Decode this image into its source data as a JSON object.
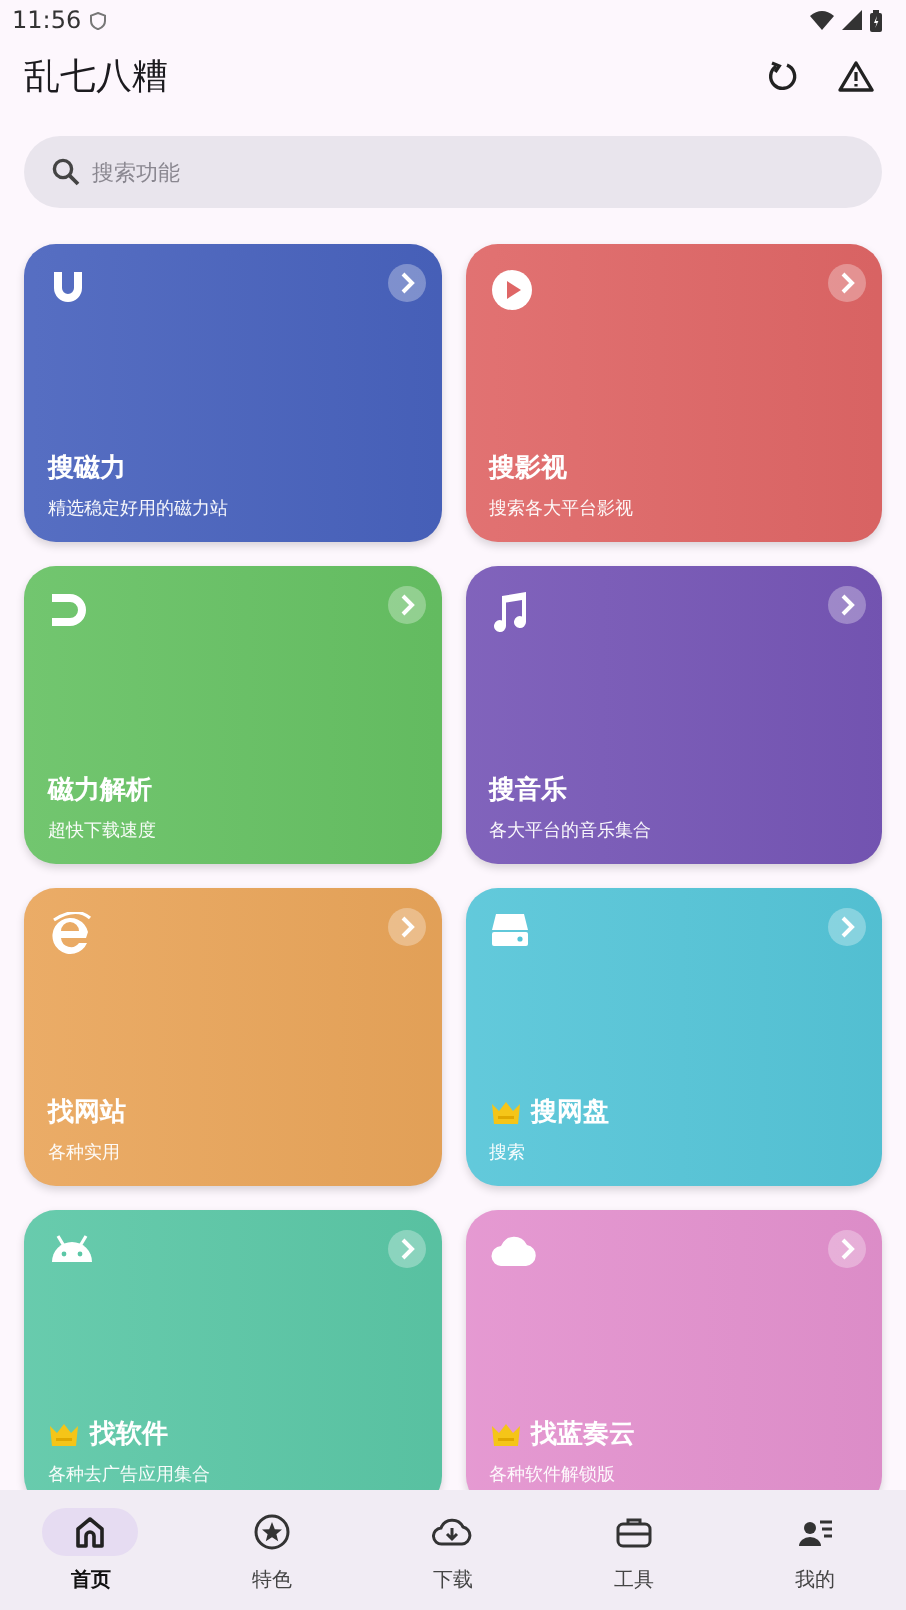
{
  "status_bar": {
    "time": "11:56"
  },
  "app_bar": {
    "title": "乱七八糟"
  },
  "search": {
    "placeholder": "搜索功能"
  },
  "cards": [
    {
      "title": "搜磁力",
      "subtitle": "精选稳定好用的磁力站",
      "color": "#4862bd",
      "premium": false
    },
    {
      "title": "搜影视",
      "subtitle": "搜索各大平台影视",
      "color": "#df6666",
      "premium": false
    },
    {
      "title": "磁力解析",
      "subtitle": "超快下载速度",
      "color": "#66c163",
      "premium": false
    },
    {
      "title": "搜音乐",
      "subtitle": "各大平台的音乐集合",
      "color": "#7656b6",
      "premium": false
    },
    {
      "title": "找网站",
      "subtitle": "各种实用",
      "color": "#e9a55a",
      "premium": false
    },
    {
      "title": "搜网盘",
      "subtitle": "搜索",
      "color": "#55c5d8",
      "premium": true
    },
    {
      "title": "找软件",
      "subtitle": "各种去广告应用集合",
      "color": "#5bc7a6",
      "premium": true
    },
    {
      "title": "找蓝奏云",
      "subtitle": "各种软件解锁版",
      "color": "#e391ce",
      "premium": true
    }
  ],
  "nav": [
    {
      "label": "首页",
      "selected": true
    },
    {
      "label": "特色",
      "selected": false
    },
    {
      "label": "下载",
      "selected": false
    },
    {
      "label": "工具",
      "selected": false
    },
    {
      "label": "我的",
      "selected": false
    }
  ]
}
